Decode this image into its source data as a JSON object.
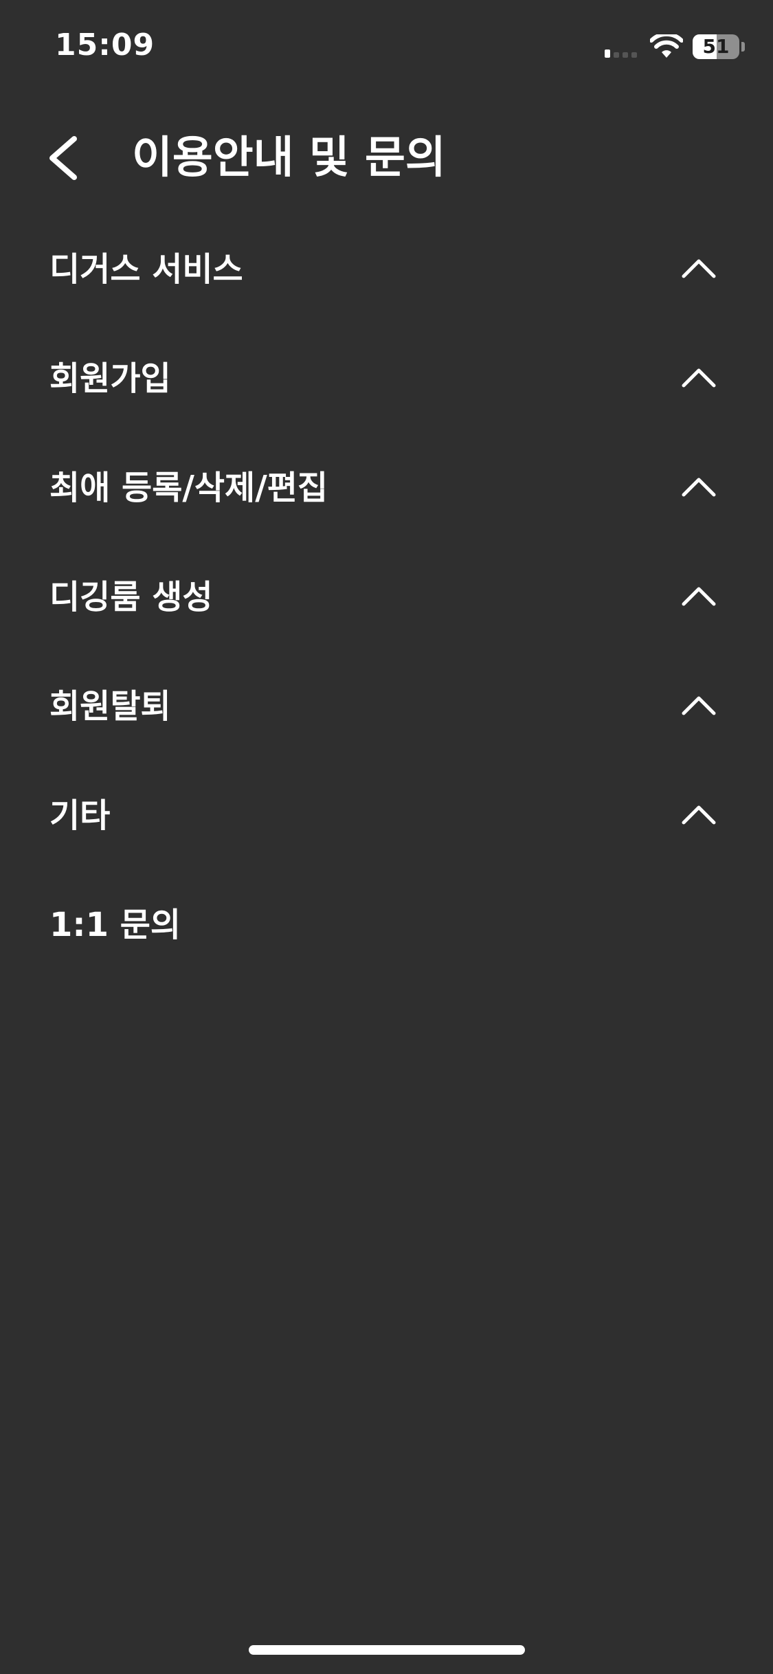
{
  "status_bar": {
    "time": "15:09",
    "battery_level": "51",
    "battery_fraction": 0.51,
    "signal_icon": "cellular-signal-icon",
    "wifi_icon": "wifi-icon"
  },
  "header": {
    "back_icon": "chevron-left-icon",
    "title": "이용안내 및 문의"
  },
  "faq": {
    "items": [
      {
        "label": "디거스 서비스",
        "icon": "chevron-up-icon"
      },
      {
        "label": "회원가입",
        "icon": "chevron-up-icon"
      },
      {
        "label": "최애 등록/삭제/편집",
        "icon": "chevron-up-icon"
      },
      {
        "label": "디깅룸 생성",
        "icon": "chevron-up-icon"
      },
      {
        "label": "회원탈퇴",
        "icon": "chevron-up-icon"
      },
      {
        "label": "기타",
        "icon": "chevron-up-icon"
      },
      {
        "label": "1:1 문의"
      }
    ]
  },
  "colors": {
    "background": "#2f2f2f",
    "text": "#ffffff"
  }
}
